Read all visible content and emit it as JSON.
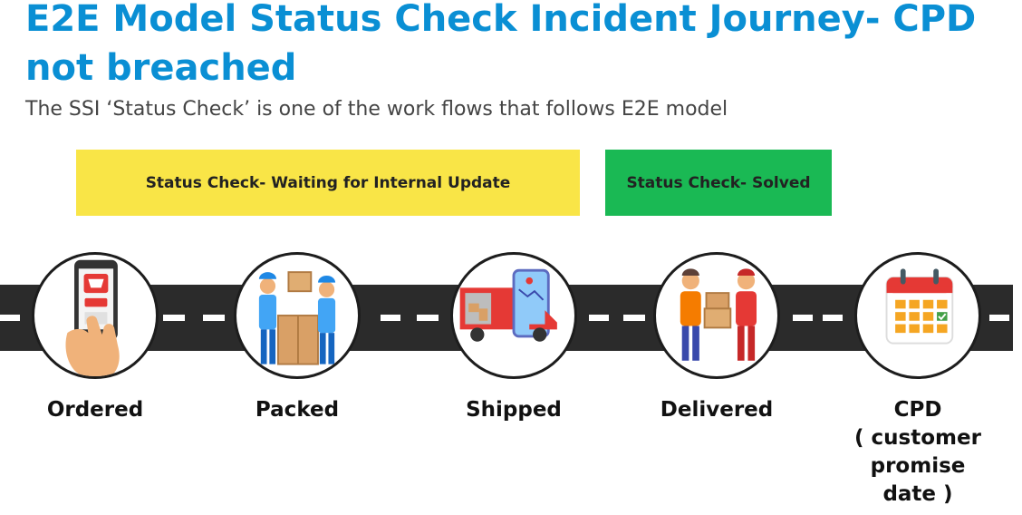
{
  "header": {
    "title": "E2E Model Status Check Incident Journey- CPD not breached",
    "subtitle": "The SSI ‘Status Check’ is one of the work flows that follows E2E model"
  },
  "status_bands": [
    {
      "label": "Status Check- Waiting for Internal Update",
      "color": "#f9e547"
    },
    {
      "label": "Status Check- Solved",
      "color": "#1ab954"
    }
  ],
  "stages": [
    {
      "label": "Ordered",
      "icon": "phone-buy-icon"
    },
    {
      "label": "Packed",
      "icon": "workers-packing-box-icon"
    },
    {
      "label": "Shipped",
      "icon": "delivery-truck-map-icon"
    },
    {
      "label": "Delivered",
      "icon": "package-handover-icon"
    },
    {
      "label": "CPD",
      "sublabel_lines": [
        "( customer",
        "promise",
        "date )"
      ],
      "icon": "calendar-icon"
    }
  ],
  "colors": {
    "title": "#0a8fd4",
    "road": "#2b2b2b",
    "lane_marking": "#ffffff"
  }
}
